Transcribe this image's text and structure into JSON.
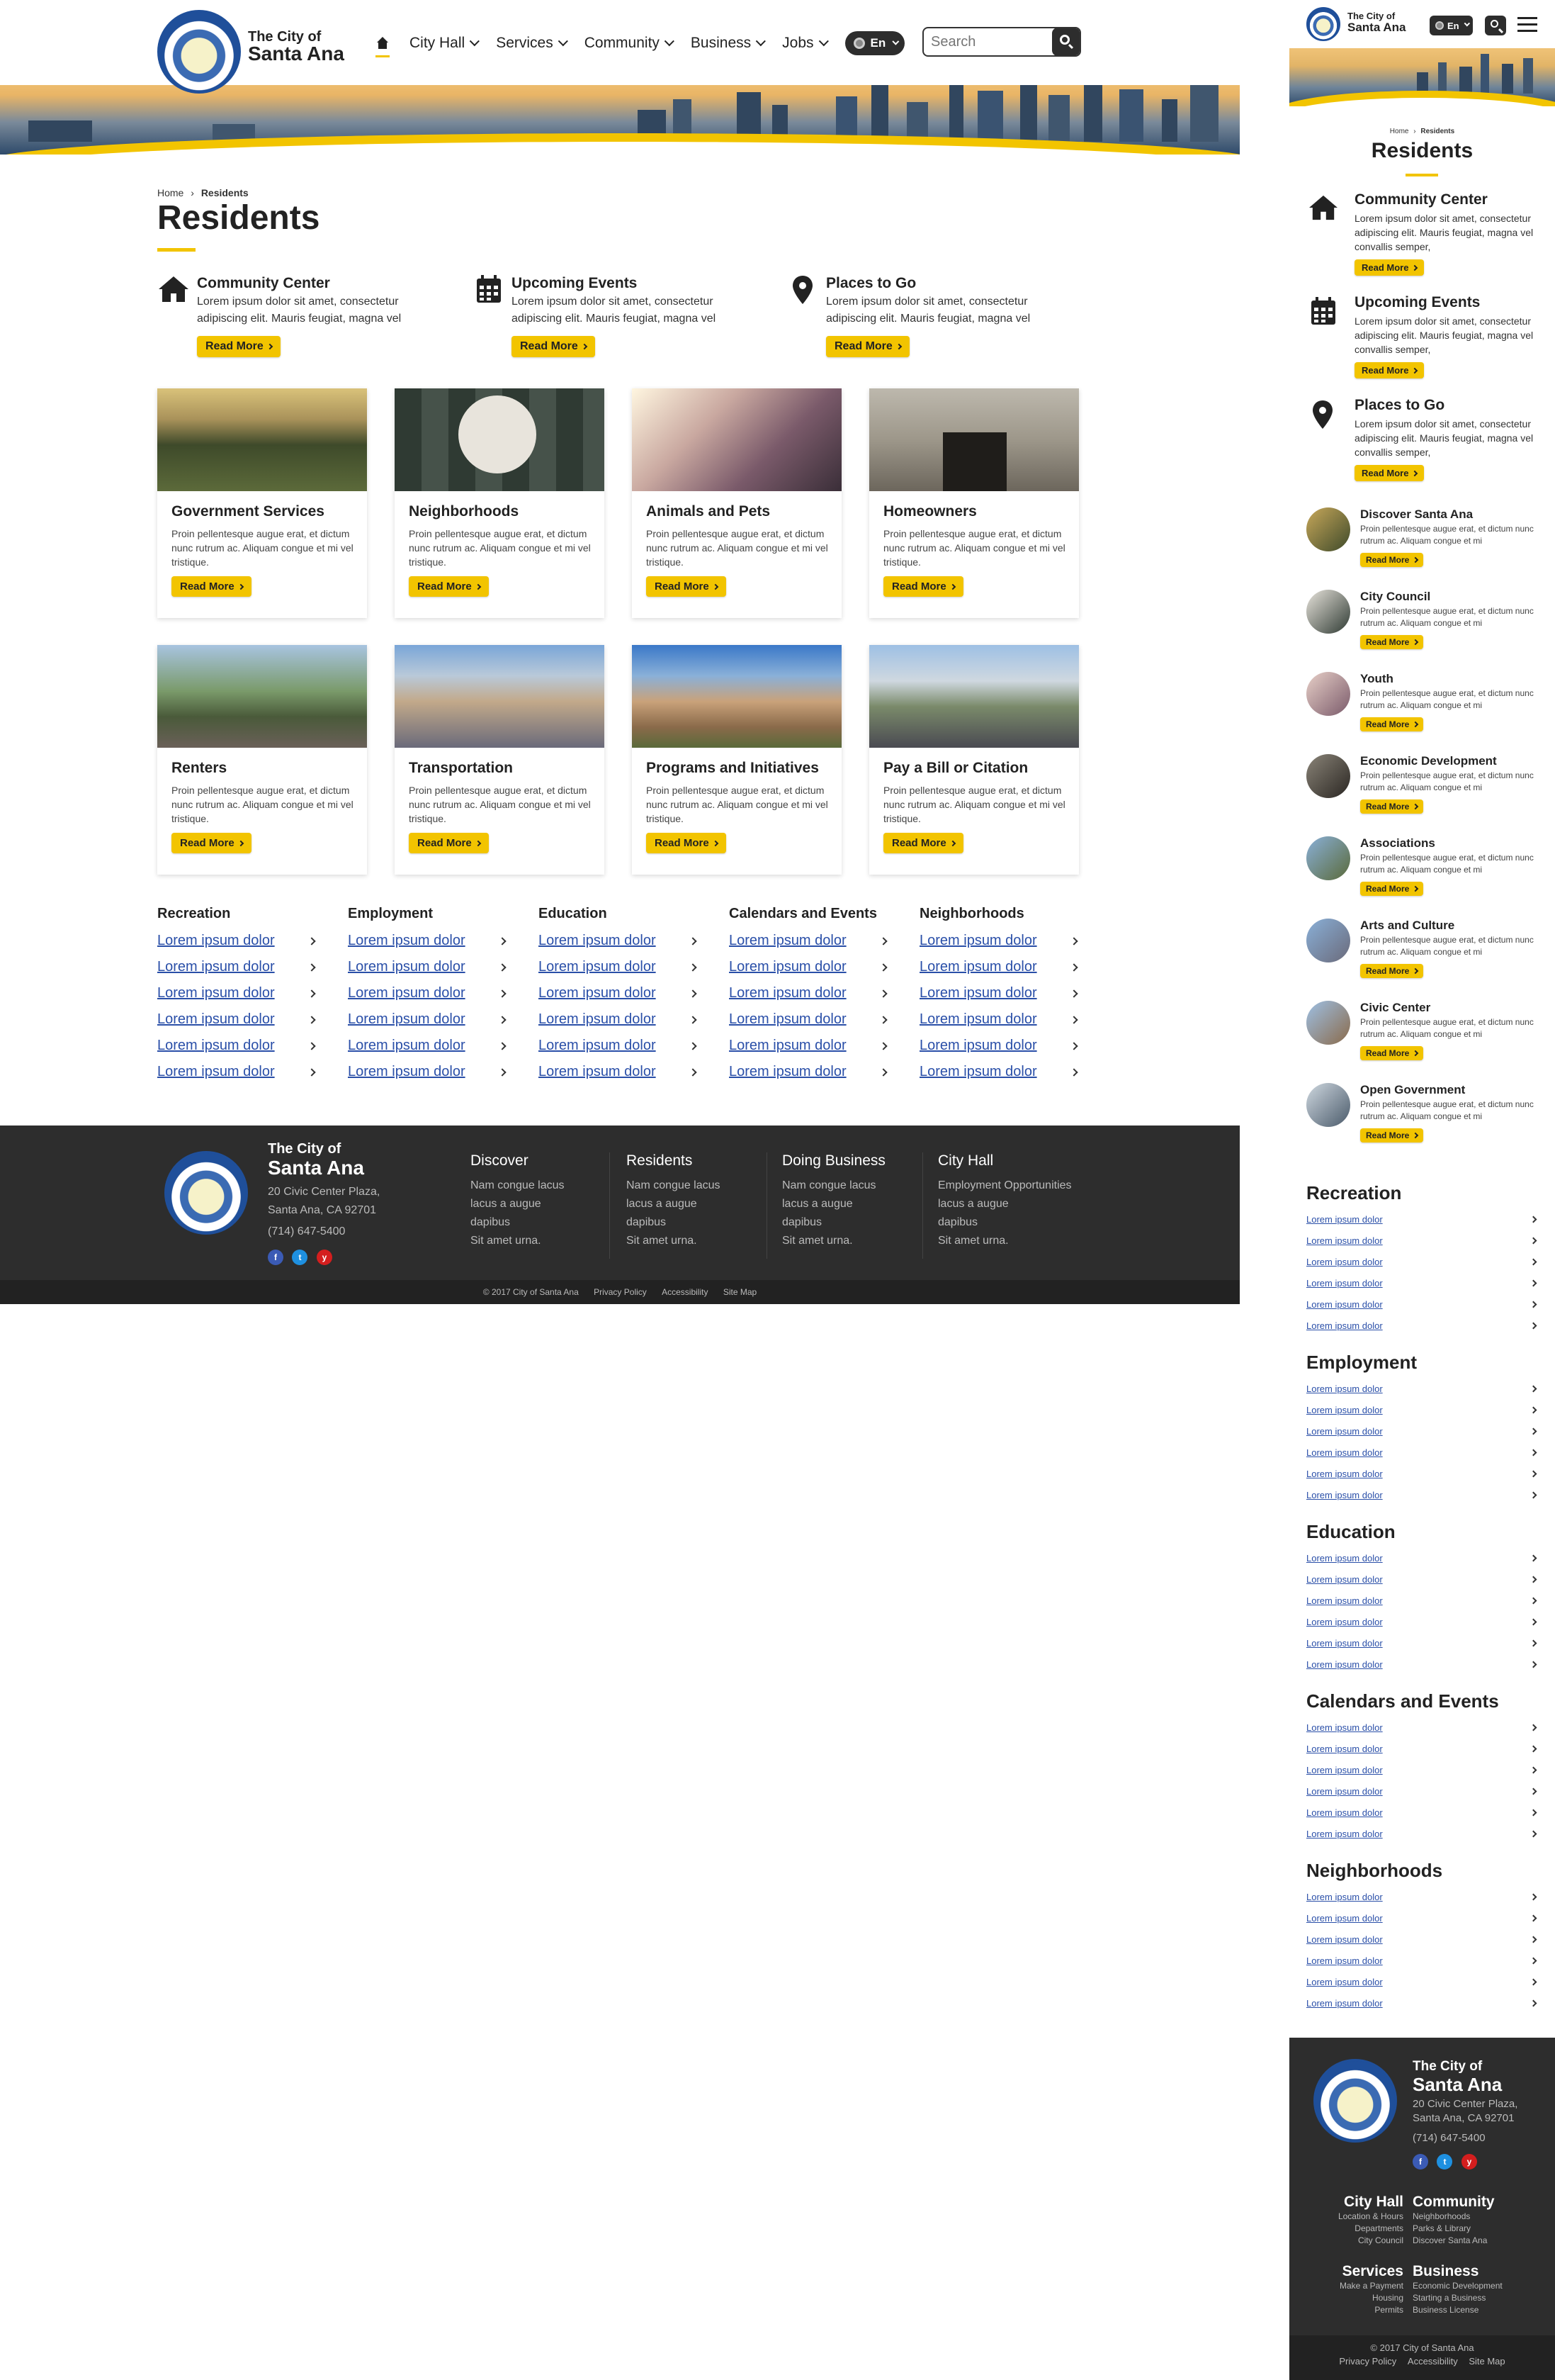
{
  "brand": {
    "city_small": "The City of",
    "city_big": "Santa Ana"
  },
  "nav": {
    "items": [
      {
        "label": "City Hall"
      },
      {
        "label": "Services"
      },
      {
        "label": "Community"
      },
      {
        "label": "Business"
      },
      {
        "label": "Jobs"
      }
    ],
    "lang": "En",
    "search_placeholder": "Search"
  },
  "breadcrumb": {
    "home": "Home",
    "current": "Residents"
  },
  "page_title": "Residents",
  "features": [
    {
      "title": "Community Center",
      "text": "Lorem ipsum dolor sit amet, consectetur adipiscing elit. Mauris feugiat, magna vel",
      "button": "Read More",
      "icon": "home-icon"
    },
    {
      "title": "Upcoming Events",
      "text": "Lorem ipsum dolor sit amet, consectetur adipiscing elit. Mauris feugiat, magna vel",
      "button": "Read More",
      "icon": "calendar-icon"
    },
    {
      "title": "Places to Go",
      "text": "Lorem ipsum dolor sit amet, consectetur adipiscing elit. Mauris feugiat, magna vel",
      "button": "Read More",
      "icon": "map-pin-icon"
    }
  ],
  "cards": [
    {
      "title": "Government Services",
      "text": "Proin pellentesque augue erat, et dictum nunc rutrum ac. Aliquam congue et mi vel tristique.",
      "button": "Read More"
    },
    {
      "title": "Neighborhoods",
      "text": "Proin pellentesque augue erat, et dictum nunc rutrum ac. Aliquam congue et mi vel tristique.",
      "button": "Read More"
    },
    {
      "title": "Animals and Pets",
      "text": "Proin pellentesque augue erat, et dictum nunc rutrum ac. Aliquam congue et mi vel tristique.",
      "button": "Read More"
    },
    {
      "title": "Homeowners",
      "text": "Proin pellentesque augue erat, et dictum nunc rutrum ac. Aliquam congue et mi vel tristique.",
      "button": "Read More"
    },
    {
      "title": "Renters",
      "text": "Proin pellentesque augue erat, et dictum nunc rutrum ac. Aliquam congue et mi vel tristique.",
      "button": "Read More"
    },
    {
      "title": "Transportation",
      "text": "Proin pellentesque augue erat, et dictum nunc rutrum ac. Aliquam congue et mi vel tristique.",
      "button": "Read More"
    },
    {
      "title": "Programs and Initiatives",
      "text": "Proin pellentesque augue erat, et dictum nunc rutrum ac. Aliquam congue et mi vel tristique.",
      "button": "Read More"
    },
    {
      "title": "Pay a Bill or Citation",
      "text": "Proin pellentesque augue erat, et dictum nunc rutrum ac. Aliquam congue et mi vel tristique.",
      "button": "Read More"
    }
  ],
  "link_columns": [
    {
      "title": "Recreation",
      "links": [
        "Lorem ipsum dolor",
        "Lorem ipsum dolor",
        "Lorem ipsum dolor",
        "Lorem ipsum dolor",
        "Lorem ipsum dolor",
        "Lorem ipsum dolor"
      ]
    },
    {
      "title": "Employment",
      "links": [
        "Lorem ipsum dolor",
        "Lorem ipsum dolor",
        "Lorem ipsum dolor",
        "Lorem ipsum dolor",
        "Lorem ipsum dolor",
        "Lorem ipsum dolor"
      ]
    },
    {
      "title": "Education",
      "links": [
        "Lorem ipsum dolor",
        "Lorem ipsum dolor",
        "Lorem ipsum dolor",
        "Lorem ipsum dolor",
        "Lorem ipsum dolor",
        "Lorem ipsum dolor"
      ]
    },
    {
      "title": "Calendars and Events",
      "links": [
        "Lorem ipsum dolor",
        "Lorem ipsum dolor",
        "Lorem ipsum dolor",
        "Lorem ipsum dolor",
        "Lorem ipsum dolor",
        "Lorem ipsum dolor"
      ]
    },
    {
      "title": "Neighborhoods",
      "links": [
        "Lorem ipsum dolor",
        "Lorem ipsum dolor",
        "Lorem ipsum dolor",
        "Lorem ipsum dolor",
        "Lorem ipsum dolor",
        "Lorem ipsum dolor"
      ]
    }
  ],
  "footer": {
    "address1": "20 Civic Center Plaza,",
    "address2": "Santa Ana, CA 92701",
    "phone": "(714) 647-5400",
    "social": [
      "f",
      "t",
      "y"
    ],
    "columns": [
      {
        "title": "Discover",
        "lines": [
          "Nam congue lacus",
          "lacus a augue",
          "dapibus",
          "Sit amet urna."
        ]
      },
      {
        "title": "Residents",
        "lines": [
          "Nam congue lacus",
          "lacus a augue",
          "dapibus",
          "Sit amet urna."
        ]
      },
      {
        "title": "Doing Business",
        "lines": [
          "Nam congue lacus",
          "lacus a augue",
          "dapibus",
          "Sit amet urna."
        ]
      },
      {
        "title": "City Hall",
        "lines": [
          "Employment Opportunities",
          "lacus a augue",
          "dapibus",
          "Sit amet urna."
        ]
      }
    ],
    "copyright": "© 2017 City of Santa Ana",
    "links": [
      "Privacy Policy",
      "Accessibility",
      "Site Map"
    ]
  },
  "mobile": {
    "circles": [
      {
        "title": "Discover Santa Ana",
        "text": "Proin pellentesque augue erat, et dictum nunc rutrum ac. Aliquam congue et mi",
        "button": "Read More"
      },
      {
        "title": "City Council",
        "text": "Proin pellentesque augue erat, et dictum nunc rutrum ac. Aliquam congue et mi",
        "button": "Read More"
      },
      {
        "title": "Youth",
        "text": "Proin pellentesque augue erat, et dictum nunc rutrum ac. Aliquam congue et mi",
        "button": "Read More"
      },
      {
        "title": "Economic Development",
        "text": "Proin pellentesque augue erat, et dictum nunc rutrum ac. Aliquam congue et mi",
        "button": "Read More"
      },
      {
        "title": "Associations",
        "text": "Proin pellentesque augue erat, et dictum nunc rutrum ac. Aliquam congue et mi",
        "button": "Read More"
      },
      {
        "title": "Arts and Culture",
        "text": "Proin pellentesque augue erat, et dictum nunc rutrum ac. Aliquam congue et mi",
        "button": "Read More"
      },
      {
        "title": "Civic Center",
        "text": "Proin pellentesque augue erat, et dictum nunc rutrum ac. Aliquam congue et mi",
        "button": "Read More"
      },
      {
        "title": "Open Government",
        "text": "Proin pellentesque augue erat, et dictum nunc rutrum ac. Aliquam congue et mi",
        "button": "Read More"
      }
    ],
    "feature_text": "Lorem ipsum dolor sit amet, consectetur adipiscing elit. Mauris feugiat, magna vel convallis semper,",
    "footer_cols": [
      {
        "title": "City Hall",
        "lines": [
          "Location & Hours",
          "Departments",
          "City Council"
        ]
      },
      {
        "title": "Community",
        "lines": [
          "Neighborhoods",
          "Parks & Library",
          "Discover Santa Ana"
        ]
      },
      {
        "title": "Services",
        "lines": [
          "Make a Payment",
          "Housing",
          "Permits"
        ]
      },
      {
        "title": "Business",
        "lines": [
          "Economic Development",
          "Starting a Business",
          "Business License"
        ]
      }
    ]
  },
  "colors": {
    "accent": "#f2c400",
    "dark": "#2d2d2d",
    "link": "#2a4fa8"
  }
}
